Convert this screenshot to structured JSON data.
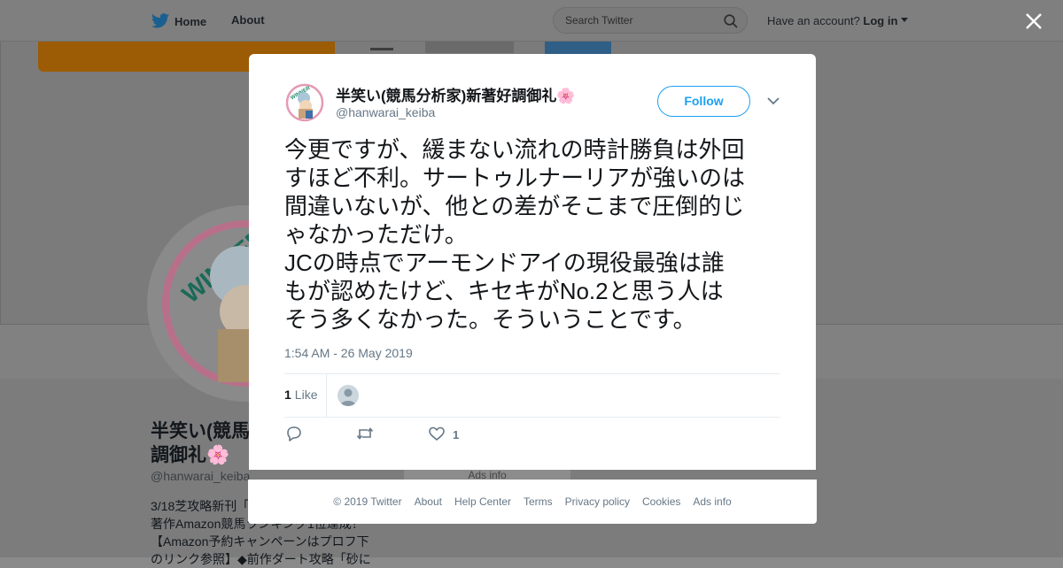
{
  "nav": {
    "home": "Home",
    "about": "About",
    "search_placeholder": "Search Twitter",
    "account_prompt": "Have an account?",
    "login": "Log in"
  },
  "background_profile": {
    "name_line1": "半笑い(競馬",
    "name_line2": "調御礼🌸",
    "handle": "@hanwarai_keiba",
    "bio": "3/18芝攻略新刊「\n著作Amazon競馬ランキング1位達成！\n【Amazon予約キャンペーンはプロフ下\nのリンク参照】◆前作ダート攻略「砂に",
    "ads_info": "Ads info"
  },
  "tweet": {
    "author_name": "半笑い(競馬分析家)新著好調御礼🌸",
    "author_handle": "@hanwarai_keiba",
    "follow_label": "Follow",
    "text": "今更ですが、緩まない流れの時計勝負は外回\nすほど不利。サートゥルナーリアが強いのは\n間違いないが、他との差がそこまで圧倒的じ\nゃなかっただけ。\nJCの時点でアーモンドアイの現役最強は誰\nもが認めたけど、キセキがNo.2と思う人は\nそう多くなかった。そういうことです。",
    "timestamp": "1:54 AM - 26 May 2019",
    "likes_count": "1",
    "likes_label": "Like",
    "action_like_count": "1"
  },
  "footer": {
    "links": [
      "© 2019 Twitter",
      "About",
      "Help Center",
      "Terms",
      "Privacy policy",
      "Cookies",
      "Ads info"
    ]
  },
  "colors": {
    "accent": "#1da1f2",
    "muted_text": "#657786",
    "primary_text": "#14171a"
  },
  "icons": [
    "twitter-bird-icon",
    "search-icon",
    "close-icon",
    "chevron-down-icon",
    "reply-icon",
    "retweet-icon",
    "heart-icon"
  ]
}
